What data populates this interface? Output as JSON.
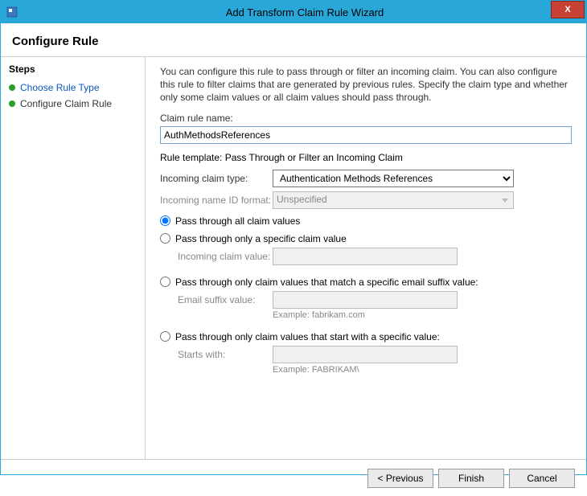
{
  "window": {
    "title": "Add Transform Claim Rule Wizard",
    "close": "X"
  },
  "header": {
    "title": "Configure Rule"
  },
  "sidebar": {
    "title": "Steps",
    "items": [
      {
        "label": "Choose Rule Type",
        "link": true
      },
      {
        "label": "Configure Claim Rule",
        "link": false
      }
    ]
  },
  "main": {
    "description": "You can configure this rule to pass through or filter an incoming claim. You can also configure this rule to filter claims that are generated by previous rules. Specify the claim type and whether only some claim values or all claim values should pass through.",
    "rule_name_label": "Claim rule name:",
    "rule_name_value": "AuthMethodsReferences",
    "template_line": "Rule template: Pass Through or Filter an Incoming Claim",
    "incoming_type_label": "Incoming claim type:",
    "incoming_type_value": "Authentication Methods References",
    "incoming_format_label": "Incoming name ID format:",
    "incoming_format_value": "Unspecified",
    "radios": {
      "all": "Pass through all claim values",
      "specific": "Pass through only a specific claim value",
      "email": "Pass through only claim values that match a specific email suffix value:",
      "starts": "Pass through only claim values that start with a specific value:"
    },
    "sublabels": {
      "claim_value": "Incoming claim value:",
      "email_value": "Email suffix value:",
      "starts_value": "Starts with:"
    },
    "examples": {
      "email": "Example: fabrikam.com",
      "starts": "Example: FABRIKAM\\"
    }
  },
  "footer": {
    "previous": "< Previous",
    "finish": "Finish",
    "cancel": "Cancel"
  }
}
